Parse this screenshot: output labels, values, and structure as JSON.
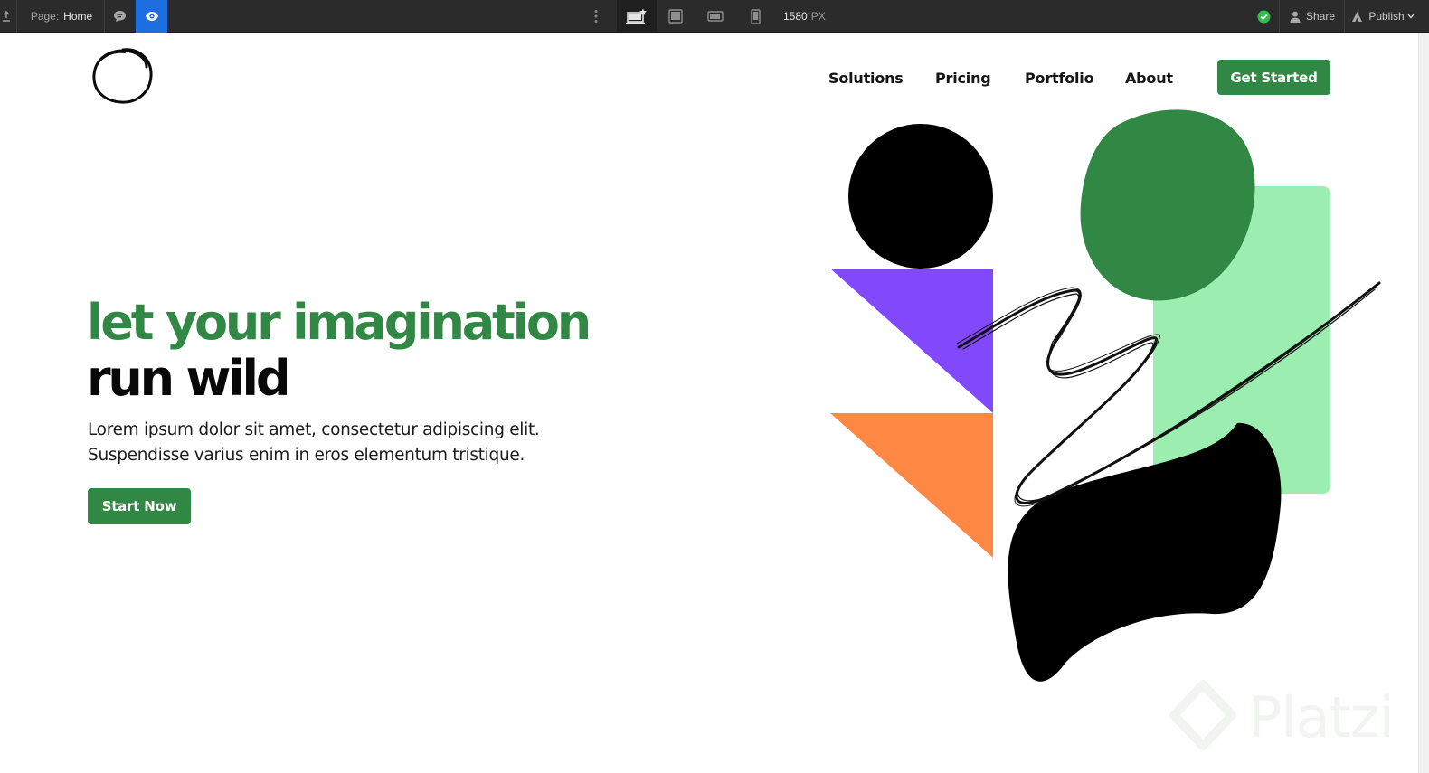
{
  "toolbar": {
    "page_label": "Page:",
    "page_name": "Home",
    "width_value": "1580",
    "width_unit": "PX",
    "share_label": "Share",
    "publish_label": "Publish",
    "status_color": "#2fbd4b",
    "preview_color": "#1d6fe0",
    "icons": [
      "export-icon",
      "comments-icon",
      "preview-eye-icon",
      "more-vertical-icon",
      "desktop-main-icon",
      "tablet-icon",
      "mobile-landscape-icon",
      "mobile-portrait-icon",
      "status-check-icon",
      "user-icon",
      "publish-icon",
      "chevron-down-icon"
    ]
  },
  "nav": {
    "links": [
      "Solutions",
      "Pricing",
      "Portfolio",
      "About"
    ],
    "cta_label": "Get Started"
  },
  "hero": {
    "title_line1": "let your imagination",
    "title_line2": "run wild",
    "subtitle_line1": "Lorem ipsum dolor sit amet, consectetur adipiscing elit.",
    "subtitle_line2": "Suspendisse varius enim in eros elementum tristique.",
    "button_label": "Start Now"
  },
  "colors": {
    "brand_green": "#318845",
    "light_green": "#9beeb0",
    "purple": "#8248fc",
    "orange": "#ff8844",
    "black": "#000000"
  },
  "watermark": {
    "text": "Platzi"
  }
}
